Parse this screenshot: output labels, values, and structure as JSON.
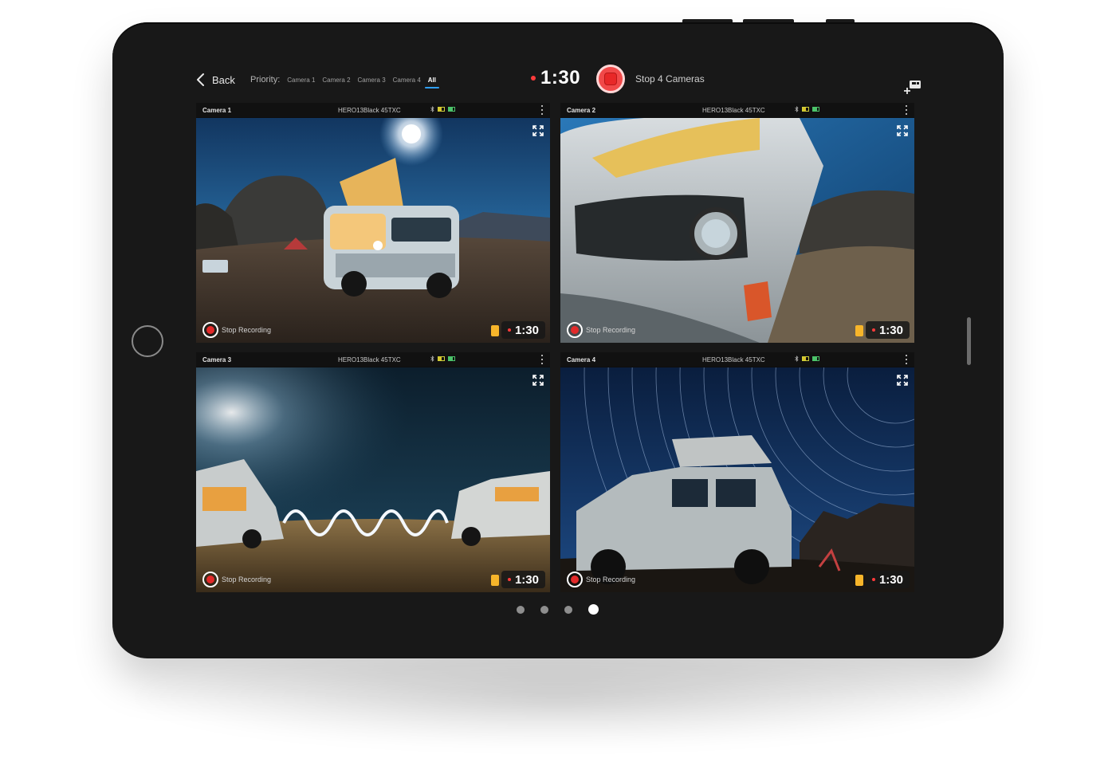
{
  "header": {
    "back_label": "Back",
    "priority_label": "Priority:",
    "priority_options": [
      "Camera 1",
      "Camera 2",
      "Camera 3",
      "Camera 4",
      "All"
    ],
    "priority_selected": "All",
    "timer": "1:30",
    "stop_all_label": "Stop 4 Cameras"
  },
  "cameras": [
    {
      "name": "Camera 1",
      "model": "HERO13Black 45TXC",
      "stop_label": "Stop Recording",
      "timer": "1:30"
    },
    {
      "name": "Camera 2",
      "model": "HERO13Black 45TXC",
      "stop_label": "Stop Recording",
      "timer": "1:30"
    },
    {
      "name": "Camera 3",
      "model": "HERO13Black 45TXC",
      "stop_label": "Stop Recording",
      "timer": "1:30"
    },
    {
      "name": "Camera 4",
      "model": "HERO13Black 45TXC",
      "stop_label": "Stop Recording",
      "timer": "1:30"
    }
  ],
  "pagination": {
    "pages": 4,
    "active": 4
  },
  "colors": {
    "recording_red": "#e22a2a",
    "accent_blue": "#2f9ff8",
    "sd_card_yellow": "#f7b52a",
    "device_body": "#181818"
  },
  "icons": [
    "chevron-left-icon",
    "add-camera-icon",
    "expand-icon",
    "more-vertical-icon",
    "bluetooth-icon",
    "battery-icon",
    "sd-card-icon",
    "record-stop-icon"
  ]
}
